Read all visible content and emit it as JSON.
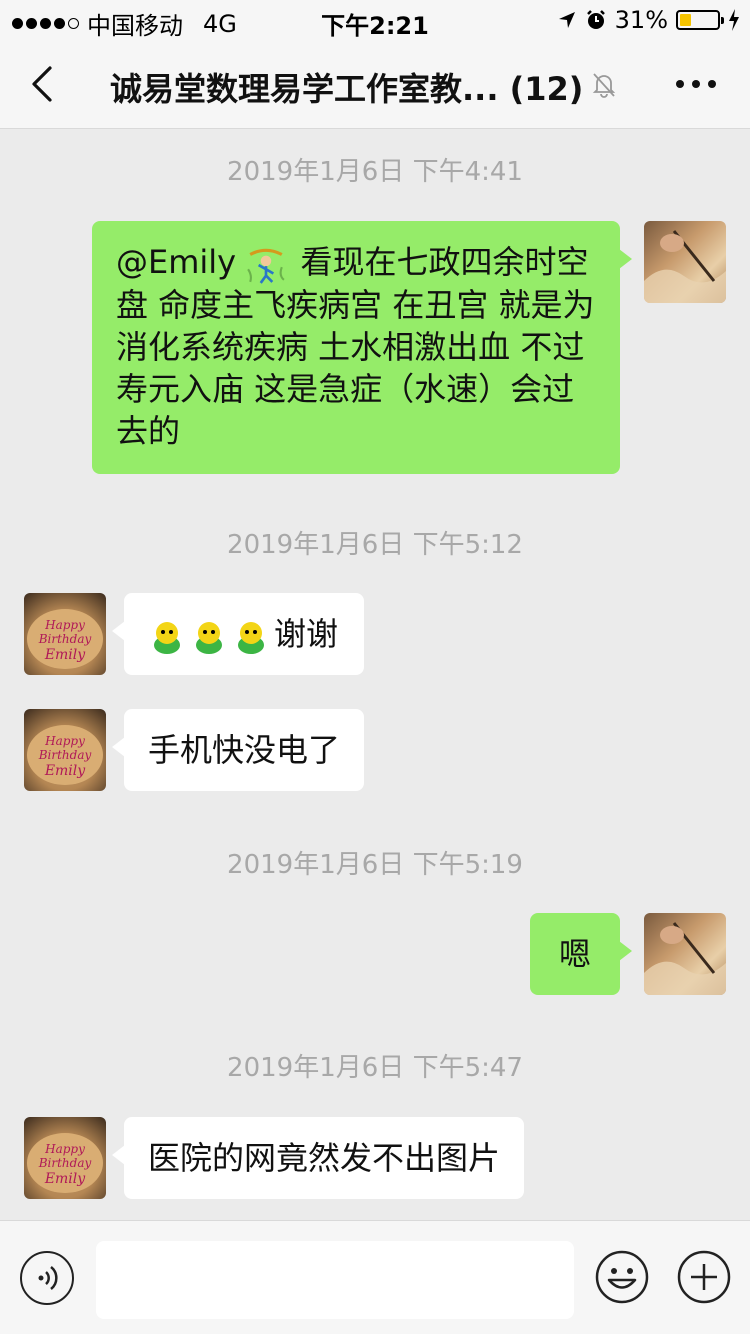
{
  "status_bar": {
    "carrier": "中国移动",
    "network": "4G",
    "time": "下午2:21",
    "battery_percent_text": "31%",
    "battery_level": 0.31
  },
  "nav": {
    "title": "诚易堂数理易学工作室教... (12)"
  },
  "messages": [
    {
      "type": "timestamp",
      "text": "2019年1月6日 下午4:41"
    },
    {
      "type": "outgoing",
      "mention": "@Emily",
      "sticker": "dancing-figure-emoji",
      "text": " 看现在七政四余时空盘 命度主飞疾病宫 在丑宫 就是为消化系统疾病 土水相激出血 不过寿元入庙 这是急症（水速）会过去的"
    },
    {
      "type": "timestamp",
      "text": "2019年1月6日 下午5:12"
    },
    {
      "type": "incoming",
      "emoji": [
        "frog-emoji",
        "frog-emoji",
        "frog-emoji"
      ],
      "text": "谢谢"
    },
    {
      "type": "incoming",
      "text": "手机快没电了"
    },
    {
      "type": "timestamp",
      "text": "2019年1月6日 下午5:19"
    },
    {
      "type": "outgoing",
      "text": "嗯"
    },
    {
      "type": "timestamp",
      "text": "2019年1月6日 下午5:47"
    },
    {
      "type": "incoming",
      "text": "医院的网竟然发不出图片"
    }
  ],
  "input_bar": {
    "placeholder": ""
  },
  "colors": {
    "outgoing_bubble": "#95ec69",
    "incoming_bubble": "#ffffff",
    "background": "#ebebeb",
    "timestamp": "#a8a8a8"
  }
}
